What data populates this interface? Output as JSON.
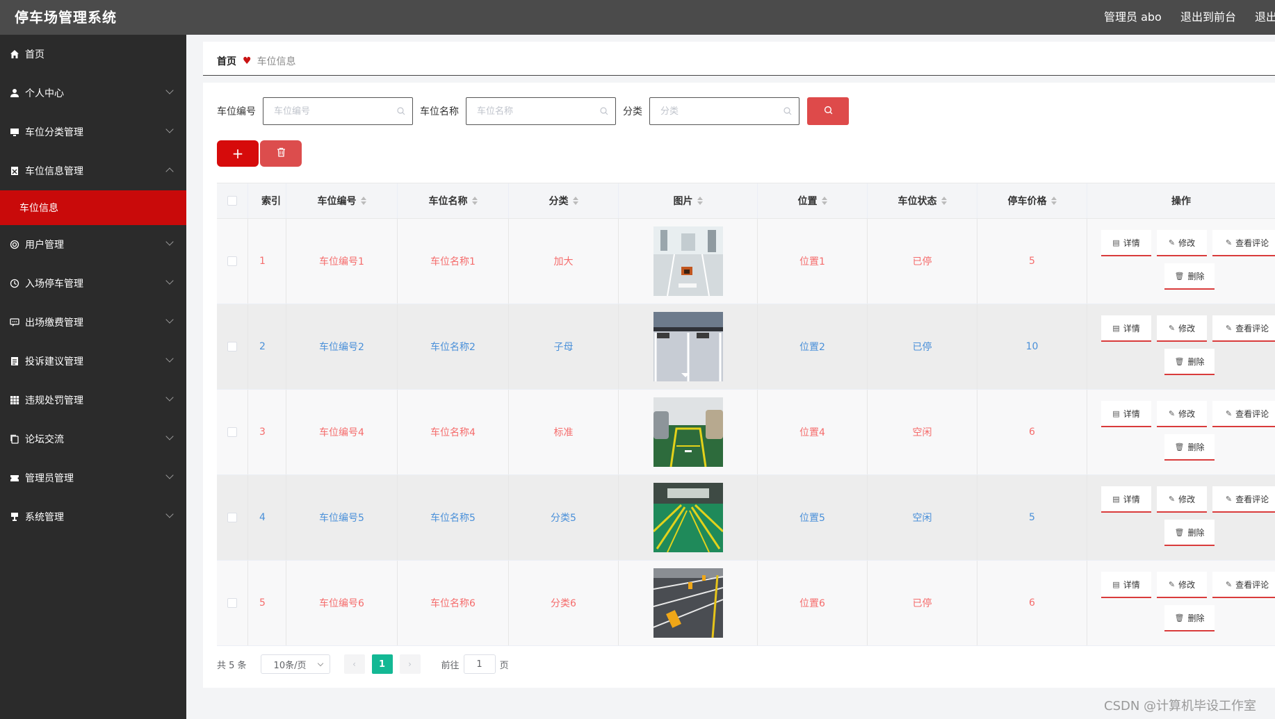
{
  "header": {
    "title": "停车场管理系统",
    "admin": "管理员 abo",
    "front": "退出到前台",
    "logout": "退出登录"
  },
  "sidebar": {
    "items": [
      {
        "label": "首页",
        "icon": "home-icon"
      },
      {
        "label": "个人中心",
        "icon": "user-icon"
      },
      {
        "label": "车位分类管理",
        "icon": "monitor-icon"
      },
      {
        "label": "车位信息管理",
        "icon": "clipboard-icon"
      },
      {
        "label": "用户管理",
        "icon": "lifebuoy-icon"
      },
      {
        "label": "入场停车管理",
        "icon": "clock-icon"
      },
      {
        "label": "出场缴费管理",
        "icon": "message-icon"
      },
      {
        "label": "投诉建议管理",
        "icon": "document-icon"
      },
      {
        "label": "违规处罚管理",
        "icon": "grid-icon"
      },
      {
        "label": "论坛交流",
        "icon": "copy-icon"
      },
      {
        "label": "管理员管理",
        "icon": "ticket-icon"
      },
      {
        "label": "系统管理",
        "icon": "trophy-icon"
      }
    ],
    "active_sub": "车位信息"
  },
  "breadcrumb": {
    "home": "首页",
    "current": "车位信息"
  },
  "search": {
    "label1": "车位编号",
    "placeholder1": "车位编号",
    "label2": "车位名称",
    "placeholder2": "车位名称",
    "label3": "分类",
    "placeholder3": "分类"
  },
  "buttons": {
    "add": "+"
  },
  "table": {
    "headers": [
      "索引",
      "车位编号",
      "车位名称",
      "分类",
      "图片",
      "位置",
      "车位状态",
      "停车价格",
      "操作"
    ],
    "rows": [
      {
        "index": "1",
        "code": "车位编号1",
        "name": "车位名称1",
        "category": "加大",
        "location": "位置1",
        "status": "已停",
        "price": "5"
      },
      {
        "index": "2",
        "code": "车位编号2",
        "name": "车位名称2",
        "category": "子母",
        "location": "位置2",
        "status": "已停",
        "price": "10"
      },
      {
        "index": "3",
        "code": "车位编号4",
        "name": "车位名称4",
        "category": "标准",
        "location": "位置4",
        "status": "空闲",
        "price": "6"
      },
      {
        "index": "4",
        "code": "车位编号5",
        "name": "车位名称5",
        "category": "分类5",
        "location": "位置5",
        "status": "空闲",
        "price": "5"
      },
      {
        "index": "5",
        "code": "车位编号6",
        "name": "车位名称6",
        "category": "分类6",
        "location": "位置6",
        "status": "已停",
        "price": "6"
      }
    ],
    "actions": {
      "detail": "详情",
      "edit": "修改",
      "comment": "查看评论",
      "delete": "删除"
    }
  },
  "pagination": {
    "total": "共 5 条",
    "page_size": "10条/页",
    "current": "1",
    "goto_prefix": "前往",
    "goto_value": "1",
    "goto_suffix": "页"
  },
  "watermark": "CSDN @计算机毕设工作室",
  "colors": {
    "topbar": "#4b4b4b",
    "sidebar": "#2b2b2b",
    "accent": "#c90a0a",
    "page_active": "#13b894"
  }
}
